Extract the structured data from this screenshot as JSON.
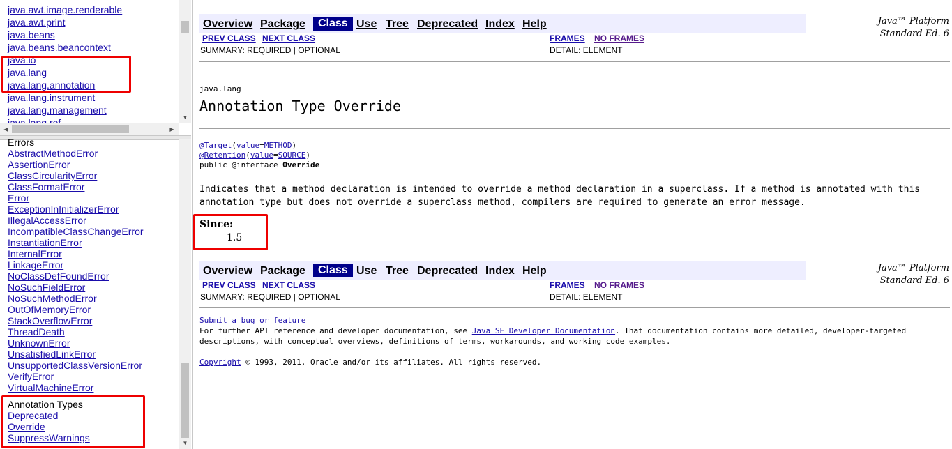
{
  "package_list": {
    "items": [
      "java.awt.image.renderable",
      "java.awt.print",
      "java.beans",
      "java.beans.beancontext",
      "java.io",
      "java.lang",
      "java.lang.annotation",
      "java.lang.instrument",
      "java.lang.management",
      "java.lang.ref"
    ]
  },
  "class_list": {
    "errors_heading": "Errors",
    "errors": [
      "AbstractMethodError",
      "AssertionError",
      "ClassCircularityError",
      "ClassFormatError",
      "Error",
      "ExceptionInInitializerError",
      "IllegalAccessError",
      "IncompatibleClassChangeError",
      "InstantiationError",
      "InternalError",
      "LinkageError",
      "NoClassDefFoundError",
      "NoSuchFieldError",
      "NoSuchMethodError",
      "OutOfMemoryError",
      "StackOverflowError",
      "ThreadDeath",
      "UnknownError",
      "UnsatisfiedLinkError",
      "UnsupportedClassVersionError",
      "VerifyError",
      "VirtualMachineError"
    ],
    "annotation_heading": "Annotation Types",
    "annotations": [
      "Deprecated",
      "Override",
      "SuppressWarnings"
    ]
  },
  "navbar": {
    "overview": "Overview",
    "package": "Package",
    "class": "Class",
    "use": "Use",
    "tree": "Tree",
    "deprecated": "Deprecated",
    "index": "Index",
    "help": "Help"
  },
  "subnav": {
    "prev_class": "PREV CLASS",
    "next_class": "NEXT CLASS",
    "frames": "FRAMES",
    "no_frames": "NO FRAMES",
    "summary": "SUMMARY: REQUIRED | OPTIONAL",
    "detail": "DETAIL: ELEMENT"
  },
  "platform": {
    "line1": "Java™ Platform",
    "line2": "Standard Ed. 6"
  },
  "content": {
    "package_name": "java.lang",
    "title": "Annotation Type Override",
    "decl_target_ann": "@Target",
    "decl_target_key": "value",
    "decl_target_val": "METHOD",
    "decl_retention_ann": "@Retention",
    "decl_retention_key": "value",
    "decl_retention_val": "SOURCE",
    "decl_line3_prefix": "public @interface ",
    "decl_line3_name": "Override",
    "description": "Indicates that a method declaration is intended to override a method declaration in a superclass. If a method is annotated with this annotation type but does not override a superclass method, compilers are required to generate an error message.",
    "since_label": "Since:",
    "since_value": "1.5"
  },
  "footer": {
    "bug_link": "Submit a bug or feature",
    "further_prefix": "For further API reference and developer documentation, see ",
    "docs_link": "Java SE Developer Documentation",
    "further_suffix": ". That documentation contains more detailed, developer-targeted descriptions, with conceptual overviews, definitions of terms, workarounds, and working code examples.",
    "copyright_link": "Copyright",
    "copyright_text": " © 1993, 2011, Oracle and/or its affiliates. All rights reserved."
  },
  "highlight_color": "#ee0000"
}
